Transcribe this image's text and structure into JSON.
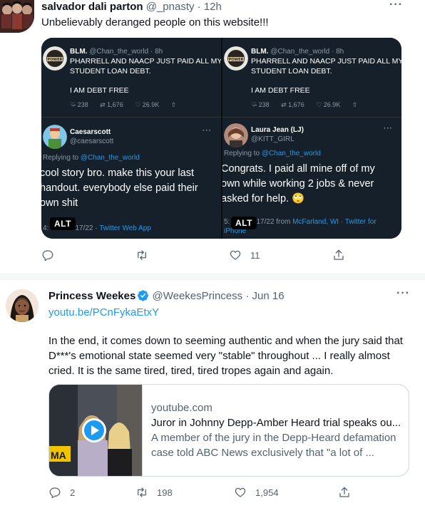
{
  "tweet1": {
    "author_name": "salvador dali parton",
    "handle": "@_pnasty",
    "separator": "·",
    "time": "12h",
    "text": "Unbelievably deranged people on this website!!!",
    "image": {
      "left": {
        "quoted": {
          "name": "BLM.",
          "handle": "@Chan_the_world",
          "time": "· 8h",
          "line1": "PHARRELL AND NAACP JUST PAID ALL MY",
          "line2": "STUDENT LOAN DEBT.",
          "line3": "I AM DEBT FREE",
          "replies": "238",
          "retweets": "1,676",
          "likes": "26.9K"
        },
        "reply": {
          "name": "Caesarscott",
          "handle": "@caesarscott",
          "replying_prefix": "Replying to",
          "replying_to": "@Chan_the_world",
          "line1": "cool story bro.  make this your last",
          "line2": "handout.  everybody else paid their",
          "line3": "own shit",
          "footer_time": "4:",
          "footer_date": "6/17/22 ·",
          "footer_client": "Twitter Web App"
        },
        "alt_label": "ALT"
      },
      "right": {
        "quoted": {
          "name": "BLM.",
          "handle": "@Chan_the_world",
          "time": "· 8h",
          "line1": "PHARRELL AND NAACP JUST PAID ALL MY",
          "line2": "STUDENT LOAN DEBT.",
          "line3": "I AM DEBT FREE",
          "replies": "238",
          "retweets": "1,676",
          "likes": "26.9K"
        },
        "reply": {
          "name": "Laura Jean (LJ)",
          "handle": "@KITT_GIRL",
          "replying_prefix": "Replying to",
          "replying_to": "@Chan_the_world",
          "line1": "Congrats. I paid all mine off of my",
          "line2": "own while working 2 jobs & never",
          "line3": "asked for help. 🙄",
          "footer_time": "5:",
          "footer_date": "6/17/22 from",
          "footer_place": "McFarland, WI",
          "footer_client": "· Twitter for",
          "footer_client2": "iPhone"
        },
        "alt_label": "ALT"
      }
    },
    "actions": {
      "replies": "",
      "retweets": "",
      "likes": "11"
    }
  },
  "tweet2": {
    "author_name": "Princess Weekes",
    "handle": "@WeekesPrincess",
    "separator": "·",
    "time": "Jun 16",
    "link": "youtu.be/PCnFykaEtxY",
    "text": "In the end, it comes down to seeming authentic and when the jury said that D***'s emotional state seemed very \"stable\" throughout ... I really almost cried. It is the same tired, tired, tired tropes again and again.",
    "card": {
      "domain": "youtube.com",
      "title": "Juror in Johnny Depp-Amber Heard trial speaks ou...",
      "desc_line1": "A member of the jury in the Depp-Heard defamation",
      "desc_line2": "case told ABC News exclusively that \"a lot of ...",
      "image_overlay": "MA"
    },
    "actions": {
      "replies": "2",
      "retweets": "198",
      "likes": "1,954"
    }
  },
  "colors": {
    "link": "#1d9bf0",
    "text": "#0f1419",
    "muted": "#536471",
    "dark_panel": "#15202b",
    "verified": "#1d9bf0"
  },
  "icons": [
    "reply-icon",
    "retweet-icon",
    "like-icon",
    "share-icon",
    "more-icon",
    "verified-icon",
    "play-icon"
  ]
}
